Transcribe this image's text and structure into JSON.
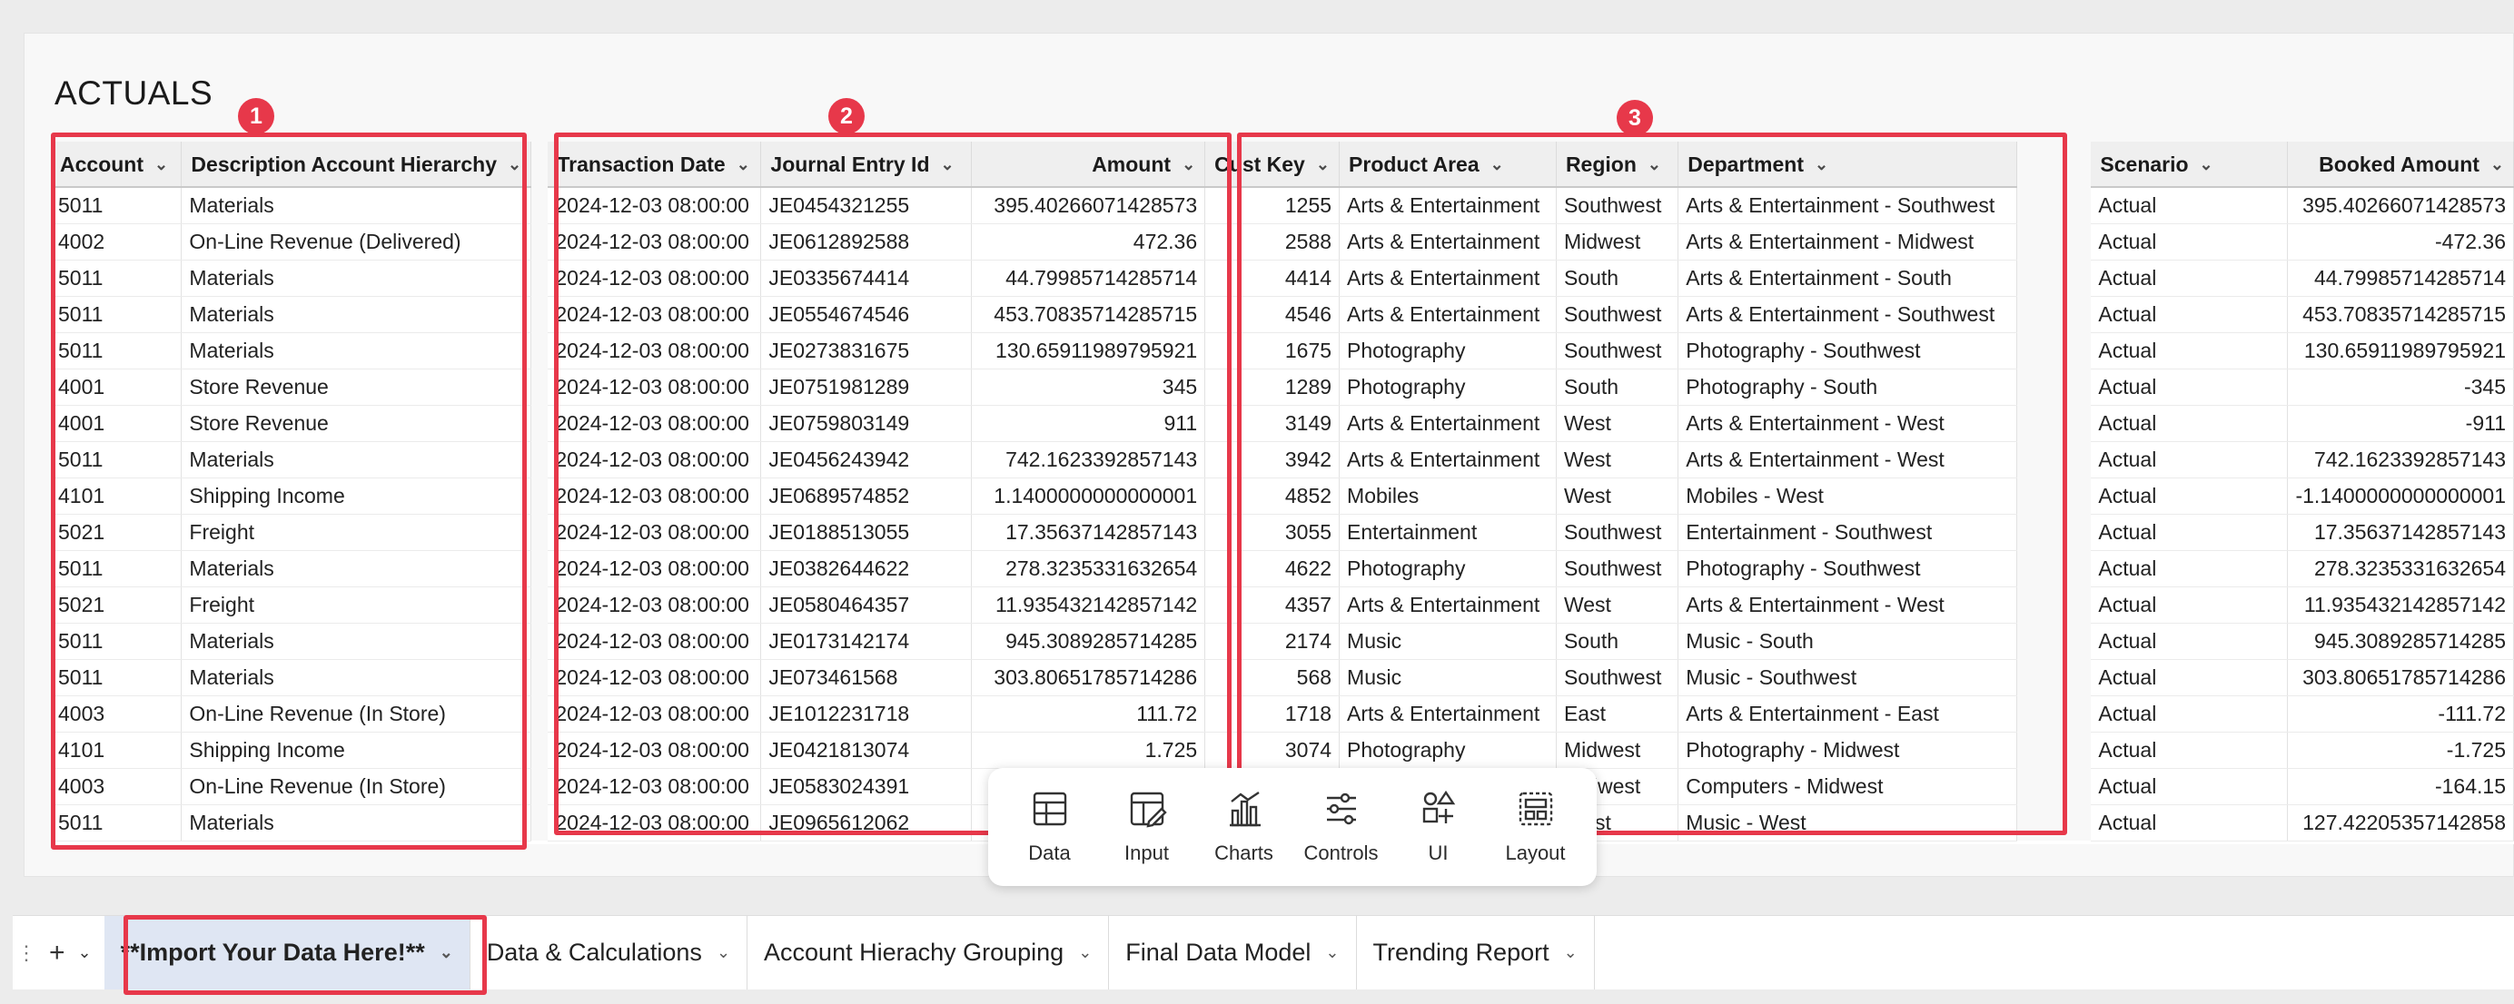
{
  "title": "ACTUALS",
  "highlight_color": "#e7384a",
  "badges": [
    "1",
    "2",
    "3"
  ],
  "columns": [
    {
      "label": "Account",
      "align": "left"
    },
    {
      "label": "Description Account Hierarchy",
      "align": "left"
    },
    {
      "label": "Transaction Date",
      "align": "left"
    },
    {
      "label": "Journal Entry Id",
      "align": "left"
    },
    {
      "label": "Amount",
      "align": "right"
    },
    {
      "label": "Cust Key",
      "align": "left"
    },
    {
      "label": "Product Area",
      "align": "left"
    },
    {
      "label": "Region",
      "align": "left"
    },
    {
      "label": "Department",
      "align": "left"
    },
    {
      "label": "Scenario",
      "align": "left"
    },
    {
      "label": "Booked Amount",
      "align": "right"
    }
  ],
  "rows": [
    [
      "5011",
      "Materials",
      "2024-12-03 08:00:00",
      "JE0454321255",
      "395.40266071428573",
      "1255",
      "Arts & Entertainment",
      "Southwest",
      "Arts & Entertainment - Southwest",
      "Actual",
      "395.40266071428573"
    ],
    [
      "4002",
      "On-Line Revenue (Delivered)",
      "2024-12-03 08:00:00",
      "JE0612892588",
      "472.36",
      "2588",
      "Arts & Entertainment",
      "Midwest",
      "Arts & Entertainment - Midwest",
      "Actual",
      "-472.36"
    ],
    [
      "5011",
      "Materials",
      "2024-12-03 08:00:00",
      "JE0335674414",
      "44.79985714285714",
      "4414",
      "Arts & Entertainment",
      "South",
      "Arts & Entertainment - South",
      "Actual",
      "44.79985714285714"
    ],
    [
      "5011",
      "Materials",
      "2024-12-03 08:00:00",
      "JE0554674546",
      "453.70835714285715",
      "4546",
      "Arts & Entertainment",
      "Southwest",
      "Arts & Entertainment - Southwest",
      "Actual",
      "453.70835714285715"
    ],
    [
      "5011",
      "Materials",
      "2024-12-03 08:00:00",
      "JE0273831675",
      "130.65911989795921",
      "1675",
      "Photography",
      "Southwest",
      "Photography - Southwest",
      "Actual",
      "130.65911989795921"
    ],
    [
      "4001",
      "Store Revenue",
      "2024-12-03 08:00:00",
      "JE0751981289",
      "345",
      "1289",
      "Photography",
      "South",
      "Photography - South",
      "Actual",
      "-345"
    ],
    [
      "4001",
      "Store Revenue",
      "2024-12-03 08:00:00",
      "JE0759803149",
      "911",
      "3149",
      "Arts & Entertainment",
      "West",
      "Arts & Entertainment - West",
      "Actual",
      "-911"
    ],
    [
      "5011",
      "Materials",
      "2024-12-03 08:00:00",
      "JE0456243942",
      "742.1623392857143",
      "3942",
      "Arts & Entertainment",
      "West",
      "Arts & Entertainment - West",
      "Actual",
      "742.1623392857143"
    ],
    [
      "4101",
      "Shipping Income",
      "2024-12-03 08:00:00",
      "JE0689574852",
      "1.1400000000000001",
      "4852",
      "Mobiles",
      "West",
      "Mobiles - West",
      "Actual",
      "-1.1400000000000001"
    ],
    [
      "5021",
      "Freight",
      "2024-12-03 08:00:00",
      "JE0188513055",
      "17.35637142857143",
      "3055",
      "Entertainment",
      "Southwest",
      "Entertainment - Southwest",
      "Actual",
      "17.35637142857143"
    ],
    [
      "5011",
      "Materials",
      "2024-12-03 08:00:00",
      "JE0382644622",
      "278.3235331632654",
      "4622",
      "Photography",
      "Southwest",
      "Photography - Southwest",
      "Actual",
      "278.3235331632654"
    ],
    [
      "5021",
      "Freight",
      "2024-12-03 08:00:00",
      "JE0580464357",
      "11.935432142857142",
      "4357",
      "Arts & Entertainment",
      "West",
      "Arts & Entertainment - West",
      "Actual",
      "11.935432142857142"
    ],
    [
      "5011",
      "Materials",
      "2024-12-03 08:00:00",
      "JE0173142174",
      "945.3089285714285",
      "2174",
      "Music",
      "South",
      "Music - South",
      "Actual",
      "945.3089285714285"
    ],
    [
      "5011",
      "Materials",
      "2024-12-03 08:00:00",
      "JE073461568",
      "303.80651785714286",
      "568",
      "Music",
      "Southwest",
      "Music - Southwest",
      "Actual",
      "303.80651785714286"
    ],
    [
      "4003",
      "On-Line Revenue (In Store)",
      "2024-12-03 08:00:00",
      "JE1012231718",
      "111.72",
      "1718",
      "Arts & Entertainment",
      "East",
      "Arts & Entertainment - East",
      "Actual",
      "-111.72"
    ],
    [
      "4101",
      "Shipping Income",
      "2024-12-03 08:00:00",
      "JE0421813074",
      "1.725",
      "3074",
      "Photography",
      "Midwest",
      "Photography - Midwest",
      "Actual",
      "-1.725"
    ],
    [
      "4003",
      "On-Line Revenue (In Store)",
      "2024-12-03 08:00:00",
      "JE0583024391",
      "",
      "",
      "",
      "Midwest",
      "Computers - Midwest",
      "Actual",
      "-164.15"
    ],
    [
      "5011",
      "Materials",
      "2024-12-03 08:00:00",
      "JE0965612062",
      "",
      "",
      "",
      "West",
      "Music - West",
      "Actual",
      "127.42205357142858"
    ]
  ],
  "toolbar": [
    {
      "label": "Data",
      "icon": "table-icon"
    },
    {
      "label": "Input",
      "icon": "input-table-icon"
    },
    {
      "label": "Charts",
      "icon": "chart-icon"
    },
    {
      "label": "Controls",
      "icon": "sliders-icon"
    },
    {
      "label": "UI",
      "icon": "shapes-icon"
    },
    {
      "label": "Layout",
      "icon": "layout-icon"
    }
  ],
  "tabs": [
    {
      "label": "**Import Your Data Here!**",
      "active": true
    },
    {
      "label": "Data & Calculations",
      "active": false
    },
    {
      "label": "Account Hierachy Grouping",
      "active": false
    },
    {
      "label": "Final Data Model",
      "active": false
    },
    {
      "label": "Trending Report",
      "active": false
    }
  ]
}
